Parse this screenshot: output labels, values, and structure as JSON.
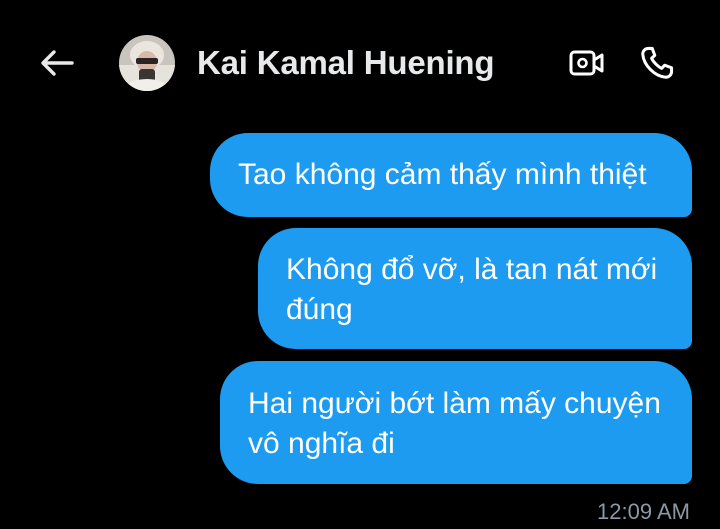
{
  "header": {
    "contact_name": "Kai Kamal Huening",
    "back_icon": "arrow-left-icon",
    "video_icon": "video-camera-icon",
    "call_icon": "phone-icon"
  },
  "messages": [
    {
      "text": "Tao không cảm thấy mình thiệt",
      "sender": "me"
    },
    {
      "text": "Không đổ vỡ, là tan nát mới đúng",
      "sender": "me"
    },
    {
      "text": "Hai người bớt làm mấy chuyện vô nghĩa đi",
      "sender": "me"
    }
  ],
  "last_timestamp": "12:09 AM",
  "colors": {
    "background": "#000000",
    "bubble": "#1d9bf0",
    "name": "#e7e9ea",
    "timestamp": "#8b98a5"
  }
}
